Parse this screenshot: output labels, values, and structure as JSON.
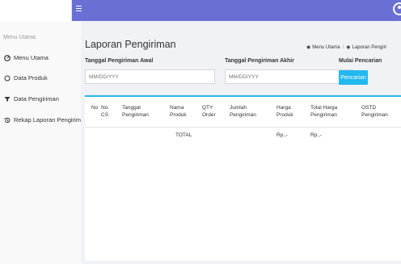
{
  "sidebar": {
    "header": "Menu Utama",
    "items": [
      {
        "label": "Menu Utama",
        "icon": "dashboard-icon"
      },
      {
        "label": "Data Produk",
        "icon": "circle-icon"
      },
      {
        "label": "Data Pengiriman",
        "icon": "filter-icon"
      },
      {
        "label": "Rekap Laporan Pengiriman",
        "icon": "history-icon"
      }
    ]
  },
  "page": {
    "title": "Laporan Pengiriman",
    "breadcrumb": [
      "Menu Utama",
      "Laporan Pengiri"
    ]
  },
  "filters": {
    "start_label": "Tanggal Pengiriman Awal",
    "start_placeholder": "MM/DD/YYY",
    "end_label": "Tanggal Pengiriman Akhir",
    "end_placeholder": "MM/DD/YYY",
    "search_label": "Mulai Pencarian",
    "search_button": "Pencarian"
  },
  "table": {
    "columns": [
      {
        "l1": "",
        "l2": "No"
      },
      {
        "l1": "No.",
        "l2": "CS"
      },
      {
        "l1": "Tanggal",
        "l2": "Pengiriman"
      },
      {
        "l1": "Nama",
        "l2": "Produk"
      },
      {
        "l1": "QTY",
        "l2": "Order"
      },
      {
        "l1": "Jumlah",
        "l2": "Pengiriman"
      },
      {
        "l1": "Harga",
        "l2": "Produk"
      },
      {
        "l1": "Total Harga",
        "l2": "Pengiriman"
      },
      {
        "l1": "OSTD",
        "l2": "Pengiriman"
      }
    ],
    "total_row": {
      "label": "TOTAL",
      "harga": "Rp.,-",
      "total_harga": "Rp.,-"
    }
  },
  "colors": {
    "navbar": "#6a6fd4",
    "accent": "#22b8f0",
    "main_bg": "#f1f2f6"
  }
}
